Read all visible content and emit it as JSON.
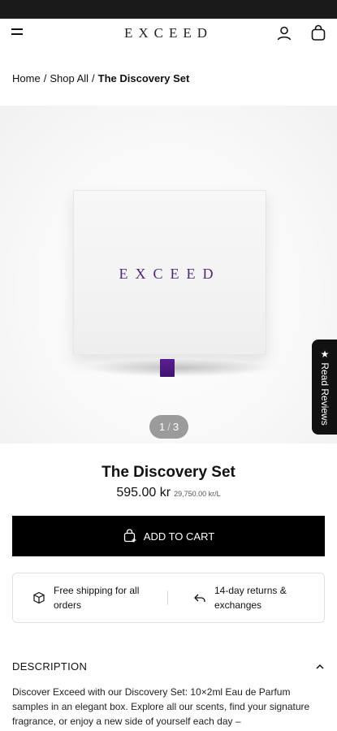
{
  "header": {
    "logo": "EXCEED"
  },
  "breadcrumb": {
    "items": [
      "Home",
      "Shop All"
    ],
    "separator": "/",
    "current": "The Discovery Set"
  },
  "gallery": {
    "box_logo": "EXCEED",
    "current_index": "1",
    "separator": "/",
    "total": "3"
  },
  "reviews_tab": {
    "label": "★ Read Reviews"
  },
  "product": {
    "title": "The Discovery Set",
    "price": "595.00 kr",
    "unit_price": "29,750.00 kr/L"
  },
  "actions": {
    "add_to_cart_label": "ADD TO CART"
  },
  "usps": [
    {
      "icon": "box-icon",
      "text": "Free shipping for all orders"
    },
    {
      "icon": "return-arrow-icon",
      "text": "14-day returns & exchanges"
    }
  ],
  "description": {
    "heading": "DESCRIPTION",
    "text": "Discover Exceed with our Discovery Set: 10×2ml Eau de Parfum samples in an elegant box. Explore all our scents, find your signature fragrance, or enjoy a new side of yourself each day –"
  },
  "colors": {
    "accent": "#4e2a78",
    "button": "#000000"
  }
}
